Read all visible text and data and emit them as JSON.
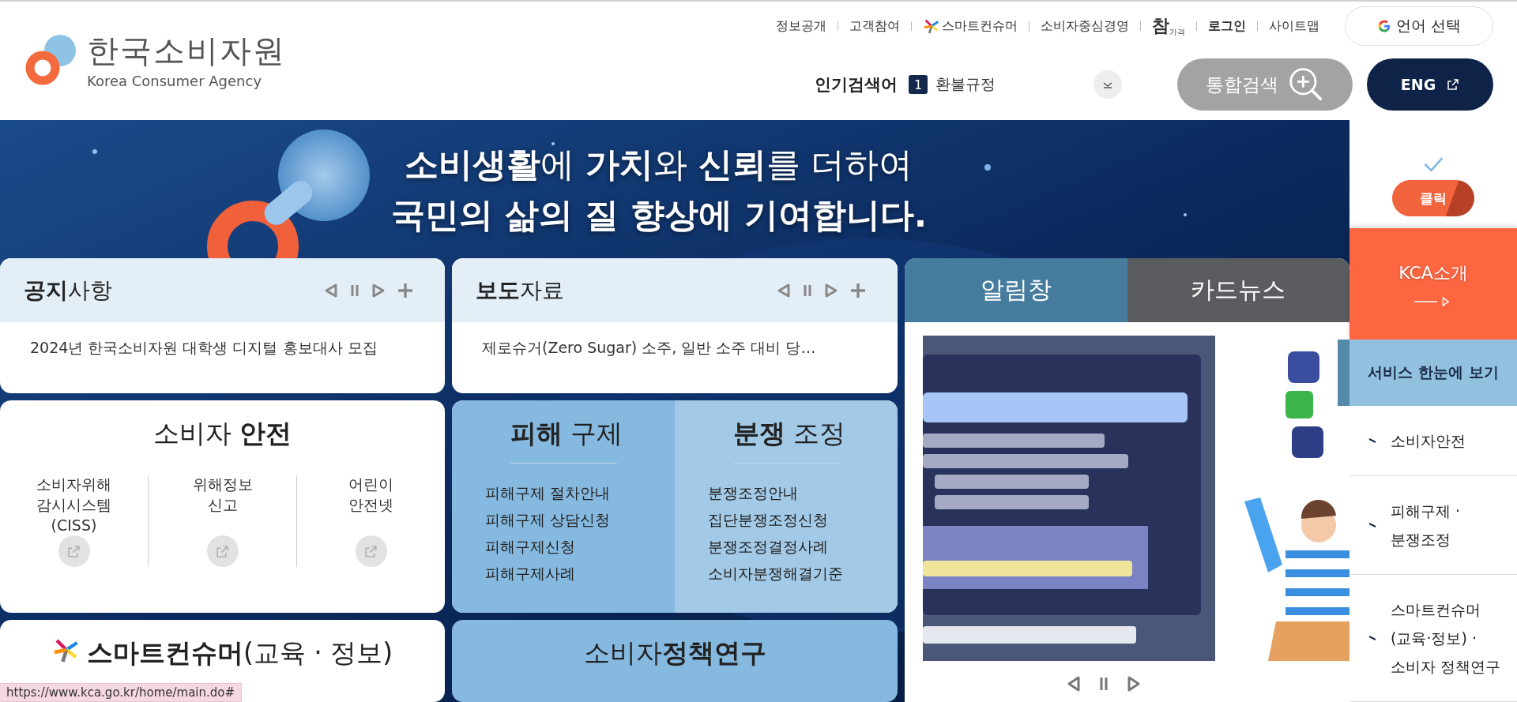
{
  "header": {
    "logo": {
      "name": "한국소비자원",
      "subtitle": "Korea Consumer Agency"
    },
    "top_links": [
      {
        "label": "정보공개",
        "kind": "text"
      },
      {
        "label": "고객참여",
        "kind": "text"
      },
      {
        "label": "스마트컨슈머",
        "kind": "smart"
      },
      {
        "label": "소비자중심경영",
        "kind": "text"
      },
      {
        "label": "참",
        "sub": "가격",
        "kind": "logo"
      },
      {
        "label": "로그인",
        "kind": "bold"
      },
      {
        "label": "사이트맵",
        "kind": "text"
      }
    ],
    "language_button": "언어 선택",
    "popular": {
      "label": "인기검색어",
      "rank": "1",
      "term": "환불규정"
    },
    "search_button": "통합검색",
    "eng_button": "ENG"
  },
  "banner": {
    "line1": "**소비생활**에 **가치**와 **신뢰**를 더하여",
    "line2": "국민의 삶의 질 향상에 기여합니다."
  },
  "notices": [
    {
      "title": "**공지**사항",
      "item": "2024년 한국소비자원 대학생 디지털 홍보대사 모집"
    },
    {
      "title": "**보도**자료",
      "item": "제로슈거(Zero Sugar) 소주, 일반 소주 대비 당…"
    }
  ],
  "safety": {
    "title": "소비자 **안전**",
    "links": [
      {
        "lines": [
          "소비자위해",
          "감시시스템",
          "(CISS)"
        ]
      },
      {
        "lines": [
          "위해정보",
          "신고"
        ]
      },
      {
        "lines": [
          "어린이",
          "안전넷"
        ]
      }
    ]
  },
  "services": [
    {
      "title": "**피해** 구제",
      "items": [
        "피해구제 절차안내",
        "피해구제 상담신청",
        "피해구제신청",
        "피해구제사례"
      ]
    },
    {
      "title": "**분쟁** 조정",
      "items": [
        "분쟁조정안내",
        "집단분쟁조정신청",
        "분쟁조정결정사례",
        "소비자분쟁해결기준"
      ]
    }
  ],
  "smart": {
    "title": "**스마트컨슈머**(교육 · 정보)"
  },
  "research": {
    "title": "소비자**정책연구**"
  },
  "alerts": {
    "tabs": [
      {
        "label": "알림창",
        "selected": true
      },
      {
        "label": "카드뉴스",
        "selected": false
      }
    ],
    "slides": [
      {
        "kind": "poster"
      },
      {
        "kind": "figure"
      }
    ]
  },
  "sidebar": {
    "badge": "클릭",
    "intro": "KCA소개",
    "section": "서비스 한눈에 보기",
    "items": [
      {
        "lines": [
          "소비자안전"
        ]
      },
      {
        "lines": [
          "피해구제 ·",
          "분쟁조정"
        ]
      },
      {
        "lines": [
          "스마트컨슈머",
          "(교육·정보) ·",
          "소비자 정책연구"
        ]
      }
    ]
  },
  "status_bar": {
    "url": "https://www.kca.go.kr/home/main.do#"
  }
}
